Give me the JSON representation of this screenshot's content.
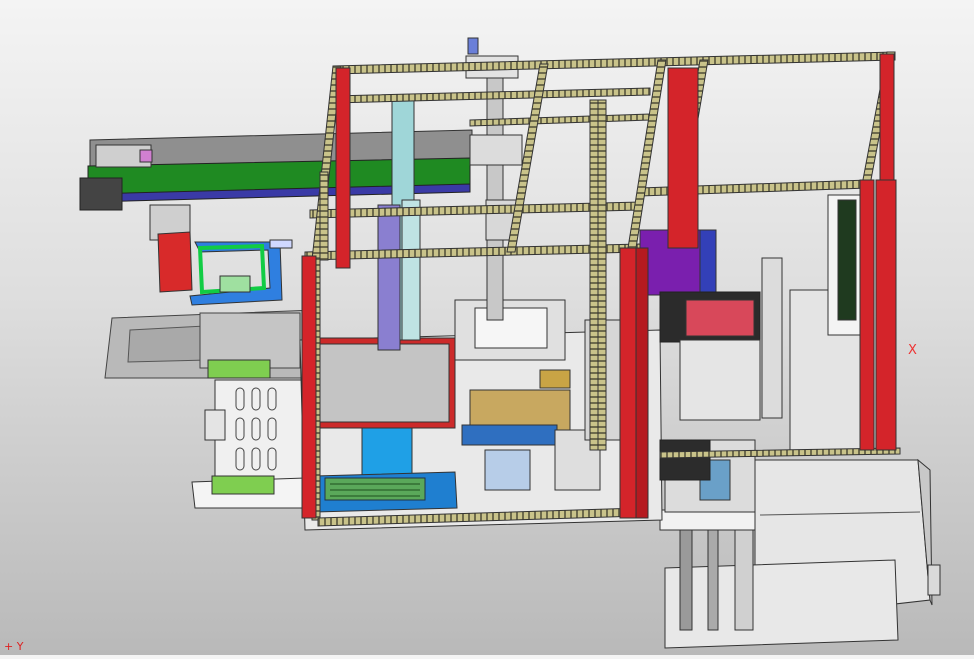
{
  "viewport": {
    "background_top": "#f4f4f4",
    "background_bottom": "#b9b9b9",
    "axis_label": "X",
    "triad_label": "+ Y"
  },
  "colors": {
    "frame_profile": "#c9c38a",
    "frame_red": "#d4242a",
    "conveyor_green": "#1f8a22",
    "conveyor_gray": "#8a8a8a",
    "bracket_blue": "#2f7fe0",
    "display_red": "#cc2a2a",
    "pcb_green": "#3c9a3c",
    "rail_cyan": "#9fd6d8",
    "rail_purple": "#8a7fd0",
    "bin_gray": "#dcdcdc"
  },
  "icons": [
    "cad-model-view",
    "axis-triad-icon"
  ]
}
